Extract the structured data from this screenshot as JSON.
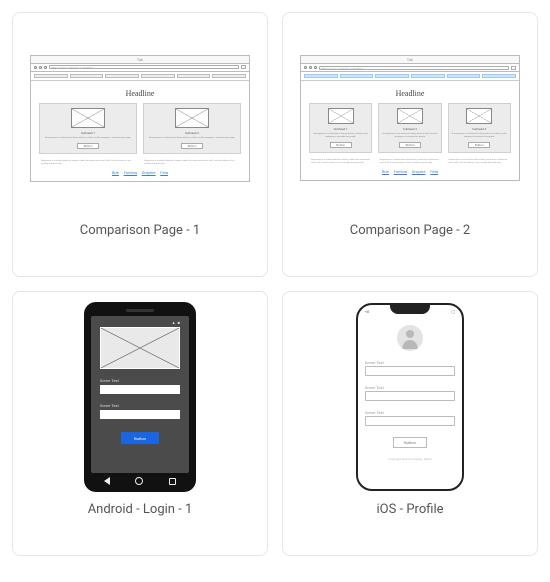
{
  "cards": [
    {
      "caption": "Comparison Page - 1"
    },
    {
      "caption": "Comparison Page - 2"
    },
    {
      "caption": "Android - Login - 1"
    },
    {
      "caption": "iOS - Profile"
    }
  ],
  "wireframe": {
    "tab_label": "Tab",
    "address": "http://www.company.com/html",
    "headline": "Headline",
    "col_subheads": [
      "Subhead 1",
      "Subhead 2",
      "Subhead 3"
    ],
    "col_text": "A comparison is a rhetorical or literary device in which a writer compares or contrasts two people.",
    "col_button": "Button",
    "paragraph": "Gorgonzola is a veined Italian blue cheese, made from unskimmed cow's milk. It can be buttery or firm, crumbly and quite salty.",
    "footer_links": [
      "Brie",
      "Fontina",
      "Gruyere",
      "Feta"
    ]
  },
  "android": {
    "field_label": "Some Text",
    "button": "Button"
  },
  "ios": {
    "field_label": "Some Text",
    "button": "Button",
    "footer": "Copyright Some Company Name"
  }
}
